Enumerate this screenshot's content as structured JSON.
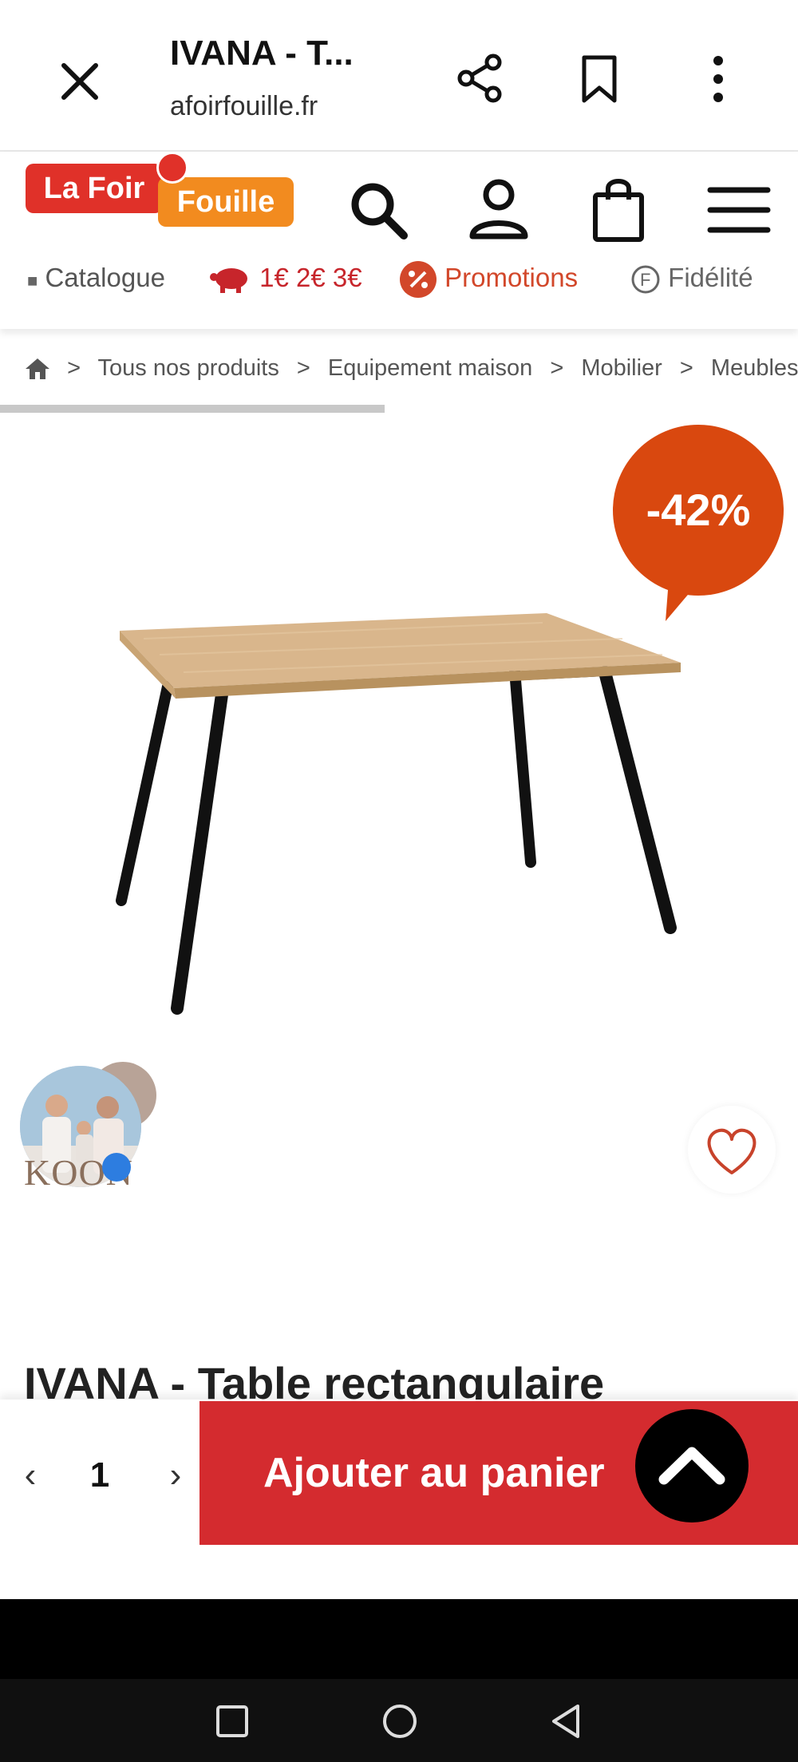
{
  "browser": {
    "title": "IVANA - T...",
    "url": "afoirfouille.fr"
  },
  "site": {
    "logo_part1": "La Foir",
    "logo_part2": "Fouille",
    "nav": {
      "catalogue": "Catalogue",
      "prices": "1€ 2€ 3€",
      "promotions": "Promotions",
      "fidelite": "Fidélité"
    }
  },
  "breadcrumb": [
    "Tous nos produits",
    "Equipement maison",
    "Mobilier",
    "Meubles"
  ],
  "product": {
    "discount": "-42%",
    "title": "IVANA - Table rectangulaire",
    "seller_logo_text": "KOON"
  },
  "cart": {
    "quantity": "1",
    "add_label": "Ajouter au panier"
  },
  "colors": {
    "brand_red": "#d42b2f",
    "brand_orange": "#f28b1f",
    "discount": "#d9480f"
  }
}
